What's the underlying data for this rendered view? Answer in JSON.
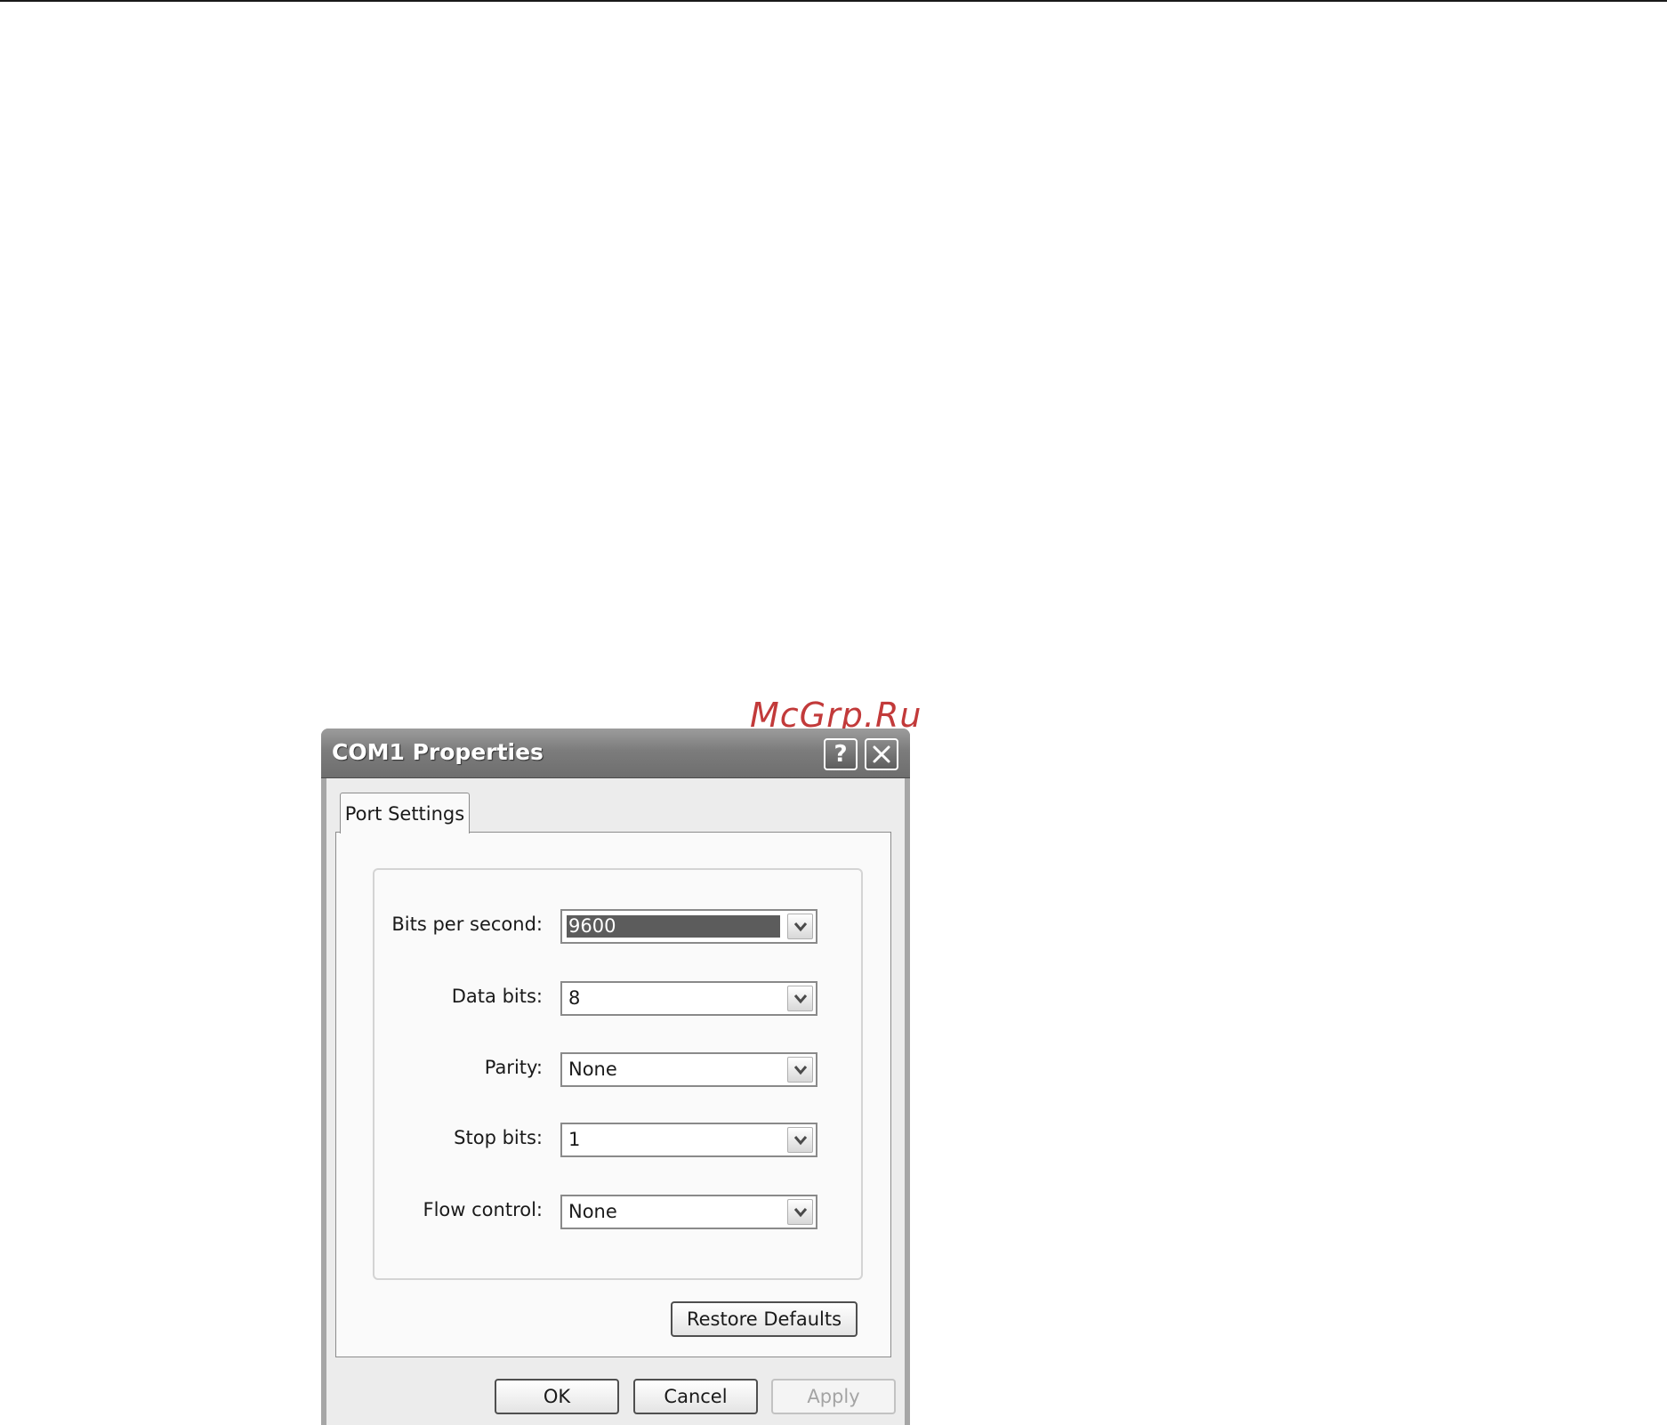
{
  "watermark": "McGrp.Ru",
  "dialog": {
    "title": "COM1 Properties",
    "help_glyph": "?",
    "icons": {
      "help": "help-icon",
      "close": "close-icon",
      "dropdown": "chevron-down-icon"
    }
  },
  "tabs": [
    {
      "label": "Port Settings",
      "active": true
    }
  ],
  "fields": {
    "bits_per_second": {
      "label": "Bits per second:",
      "value": "9600"
    },
    "data_bits": {
      "label": "Data bits:",
      "value": "8"
    },
    "parity": {
      "label": "Parity:",
      "value": "None"
    },
    "stop_bits": {
      "label": "Stop bits:",
      "value": "1"
    },
    "flow_control": {
      "label": "Flow control:",
      "value": "None"
    }
  },
  "buttons": {
    "restore_defaults": "Restore Defaults",
    "ok": "OK",
    "cancel": "Cancel",
    "apply": "Apply"
  }
}
